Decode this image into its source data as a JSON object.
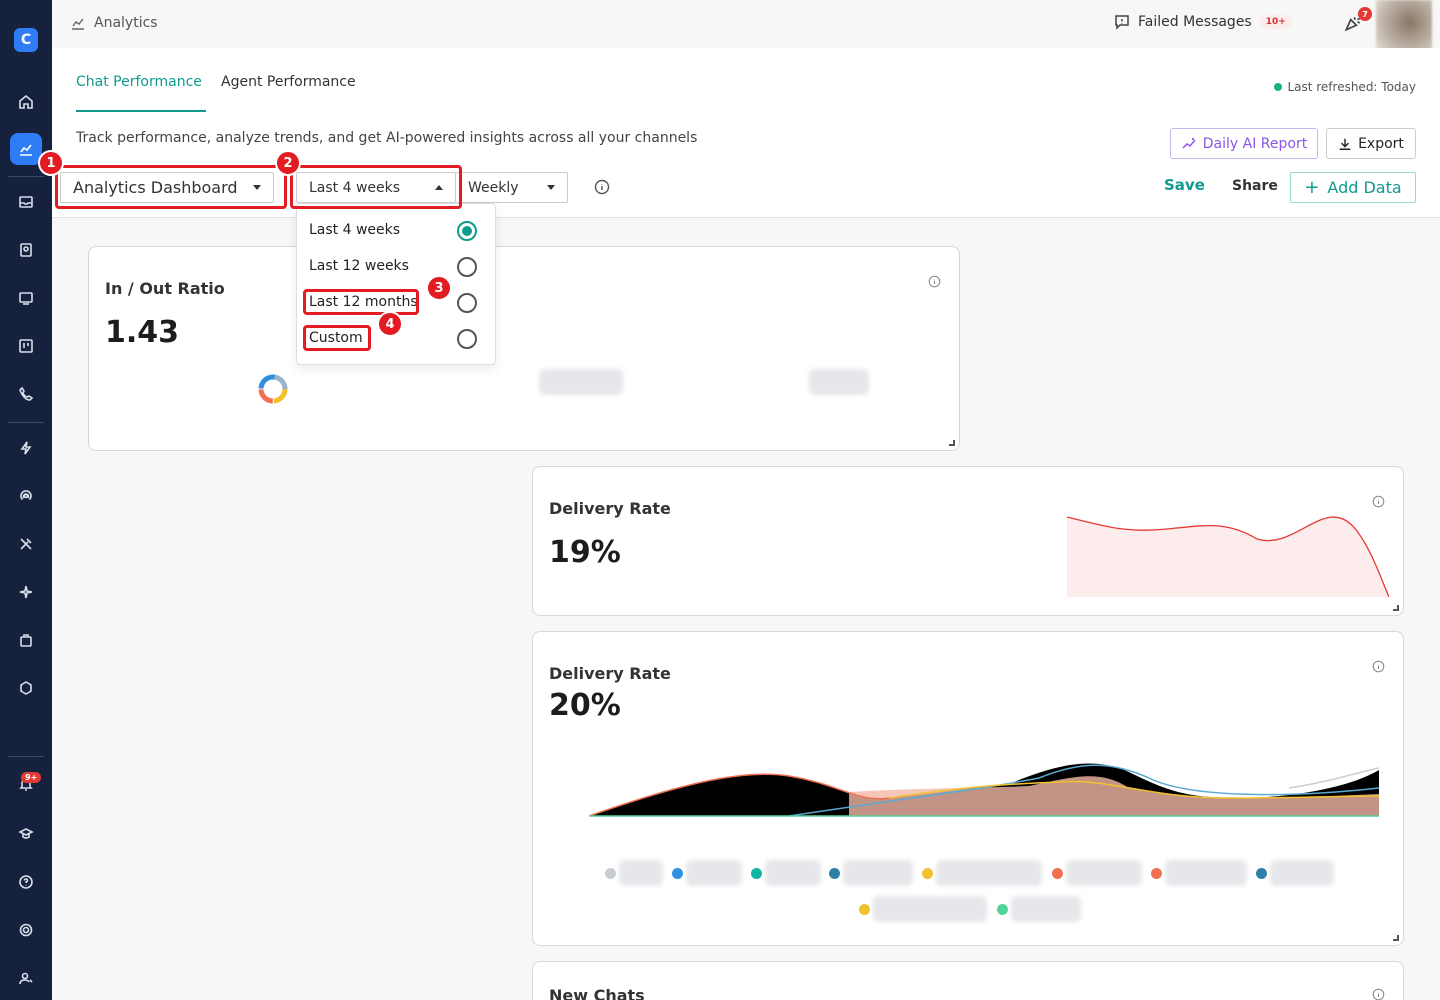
{
  "header": {
    "breadcrumb": "Analytics",
    "failed_messages_label": "Failed Messages",
    "failed_messages_count": "10+",
    "notification_count": "7"
  },
  "sidebar": {
    "alerts_badge": "9+",
    "logo_glyph": "C",
    "items": [
      "home",
      "analytics",
      "inbox",
      "contacts",
      "campaigns",
      "boards",
      "calls",
      "automation",
      "broadcast",
      "tools",
      "ai",
      "commerce",
      "integrations",
      "notifications",
      "academy",
      "help",
      "settings",
      "account"
    ]
  },
  "tabs": [
    {
      "label": "Chat Performance",
      "active": true
    },
    {
      "label": "Agent Performance",
      "active": false
    }
  ],
  "status": {
    "last_refreshed": "Last refreshed: Today"
  },
  "subtitle": "Track performance, analyze trends, and get AI-powered insights across all your channels",
  "toolbar": {
    "daily_ai_report": "Daily AI Report",
    "export": "Export",
    "dashboard_select": "Analytics Dashboard",
    "range_select": "Last 4 weeks",
    "granularity_select": "Weekly",
    "save": "Save",
    "share": "Share",
    "add_data": "Add Data"
  },
  "range_dropdown": {
    "options": [
      {
        "label": "Last 4 weeks",
        "selected": true
      },
      {
        "label": "Last 12 weeks",
        "selected": false
      },
      {
        "label": "Last 12 months",
        "selected": false
      },
      {
        "label": "Custom",
        "selected": false
      }
    ]
  },
  "annotations": [
    "1",
    "2",
    "3",
    "4"
  ],
  "cards": [
    {
      "title": "In / Out Ratio",
      "value": "1.43"
    },
    {
      "title": "Delivery Rate",
      "value": "19%"
    },
    {
      "title": "Delivery Rate",
      "value": "20%"
    },
    {
      "title": "New Chats",
      "value": ""
    }
  ],
  "colors": {
    "accent": "#0f9b8e",
    "sidebar_bg": "#16213e",
    "annotation_red": "#e31b23",
    "delivery_line": "#e53935",
    "ai_purple": "#8a57e8"
  },
  "legend_colors": [
    "#c9ccd3",
    "#2f8fe0",
    "#12b5a3",
    "#2f7ea8",
    "#f2c12e",
    "#f26f4f",
    "#f26f4f",
    "#2f7ea8",
    "#f2c12e",
    "#52d39a"
  ]
}
